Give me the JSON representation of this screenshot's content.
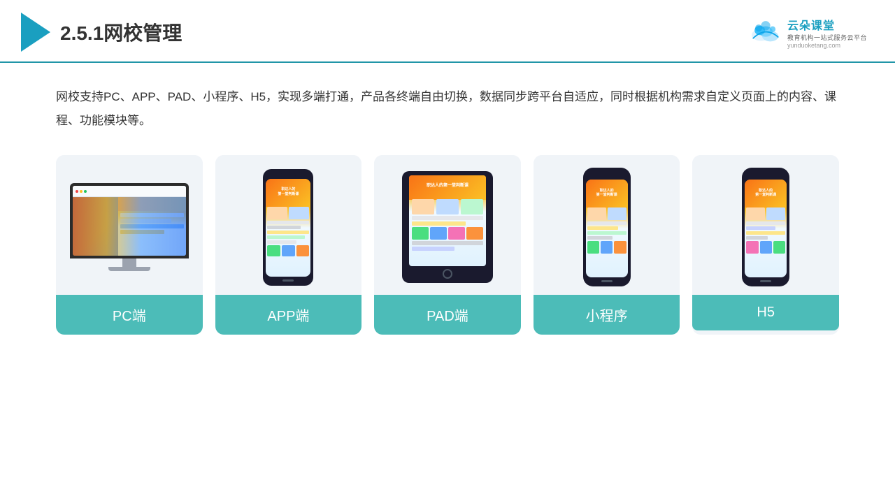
{
  "header": {
    "title": "2.5.1网校管理",
    "logo_main": "云朵课堂",
    "logo_sub": "教育机构一站式服务云平台",
    "logo_url": "yunduoketang.com"
  },
  "description": "网校支持PC、APP、PAD、小程序、H5，实现多端打通，产品各终端自由切换，数据同步跨平台自适应，同时根据机构需求自定义页面上的内容、课程、功能模块等。",
  "cards": [
    {
      "id": "pc",
      "label": "PC端"
    },
    {
      "id": "app",
      "label": "APP端"
    },
    {
      "id": "pad",
      "label": "PAD端"
    },
    {
      "id": "miniapp",
      "label": "小程序"
    },
    {
      "id": "h5",
      "label": "H5"
    }
  ],
  "colors": {
    "teal": "#4cbcb8",
    "blue_header": "#1a9fc0",
    "card_bg": "#f0f4f8"
  }
}
